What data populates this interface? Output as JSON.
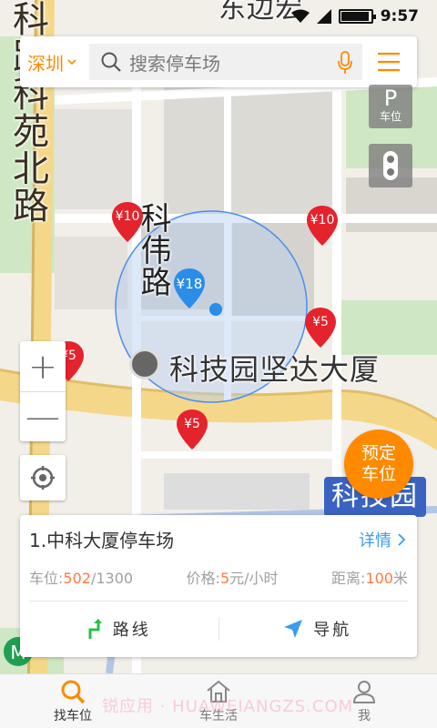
{
  "status_bar": {
    "time": "9:57"
  },
  "search": {
    "city": "深圳",
    "placeholder": "搜索停车场"
  },
  "map": {
    "road_label_vertical": "科路科苑北路",
    "top_road_label": "东边宏",
    "road_label_weiroad": "科伟路",
    "poi_label": "科技园坚达大厦",
    "metro_label": "科技园",
    "parking_button": {
      "symbol": "P",
      "label": "车位"
    },
    "price_markers": [
      {
        "label": "¥10",
        "color": "#e5232c"
      },
      {
        "label": "¥10",
        "color": "#e5232c"
      },
      {
        "label": "¥5",
        "color": "#e5232c"
      },
      {
        "label": "¥5",
        "color": "#e5232c"
      },
      {
        "label": "¥5",
        "color": "#e5232c"
      }
    ],
    "selected_marker": {
      "label": "¥18",
      "color": "#2a8de8"
    },
    "zoom_in": "+",
    "zoom_out": "—"
  },
  "book_button": {
    "label_line1": "预定",
    "label_line2": "车位",
    "color": "#ff8a00"
  },
  "parking_card": {
    "name": "1.中科大厦停车场",
    "details_label": "详情",
    "spaces_label": "车位:",
    "spaces_available": "502",
    "spaces_total": "/1300",
    "price_label": "价格:",
    "price_value": "5",
    "price_unit": "元/小时",
    "distance_label": "距离:",
    "distance_value": "100",
    "distance_unit": "米",
    "route_label": "路线",
    "navigate_label": "导航"
  },
  "bottom_nav": {
    "items": [
      {
        "label": "找车位",
        "icon": "search-icon",
        "active": true
      },
      {
        "label": "车生活",
        "icon": "home-icon",
        "active": false
      },
      {
        "label": "我",
        "icon": "user-icon",
        "active": false
      }
    ]
  },
  "watermark": "锐应用 · HUAWEIANGZS.COM",
  "colors": {
    "accent": "#ff8a00",
    "link": "#3a9df0",
    "highlight": "#ff7a45",
    "marker_red": "#e5232c",
    "marker_blue": "#2a8de8"
  }
}
